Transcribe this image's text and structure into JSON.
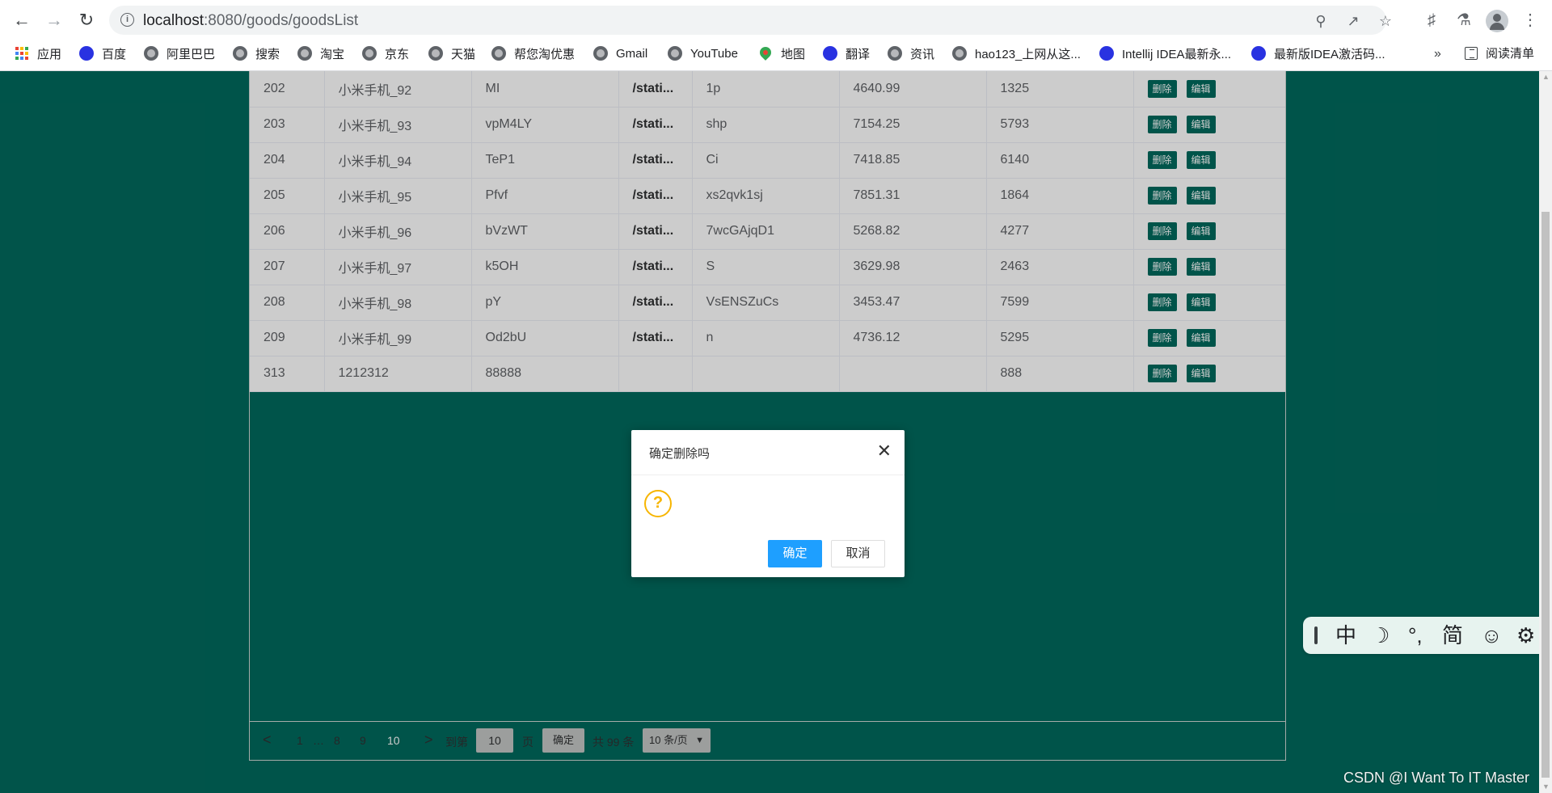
{
  "browser": {
    "url_host": "localhost",
    "url_rest": ":8080/goods/goodsList",
    "icons": [
      "back-icon",
      "forward-icon",
      "reload-icon",
      "info-icon",
      "zoom-icon",
      "share-icon",
      "star-icon",
      "extensions-icon",
      "labs-icon",
      "profile-icon",
      "menu-icon"
    ]
  },
  "bookmarks": {
    "items": [
      "应用",
      "百度",
      "阿里巴巴",
      "搜索",
      "淘宝",
      "京东",
      "天猫",
      "帮您淘优惠",
      "Gmail",
      "YouTube",
      "地图",
      "翻译",
      "资讯",
      "hao123_上网从这...",
      "Intellij IDEA最新永...",
      "最新版IDEA激活码..."
    ],
    "more": "»",
    "reading_list": "阅读清单"
  },
  "table": {
    "delete_label": "删除",
    "edit_label": "编辑",
    "rows": [
      {
        "id": "202",
        "name": "小米手机_92",
        "code": "MI",
        "img": "/stati...",
        "desc": "1p",
        "price": "4640.99",
        "stock": "1325"
      },
      {
        "id": "203",
        "name": "小米手机_93",
        "code": "vpM4LY",
        "img": "/stati...",
        "desc": "shp",
        "price": "7154.25",
        "stock": "5793"
      },
      {
        "id": "204",
        "name": "小米手机_94",
        "code": "TeP1",
        "img": "/stati...",
        "desc": "Ci",
        "price": "7418.85",
        "stock": "6140"
      },
      {
        "id": "205",
        "name": "小米手机_95",
        "code": "Pfvf",
        "img": "/stati...",
        "desc": "xs2qvk1sj",
        "price": "7851.31",
        "stock": "1864"
      },
      {
        "id": "206",
        "name": "小米手机_96",
        "code": "bVzWT",
        "img": "/stati...",
        "desc": "7wcGAjqD1",
        "price": "5268.82",
        "stock": "4277"
      },
      {
        "id": "207",
        "name": "小米手机_97",
        "code": "k5OH",
        "img": "/stati...",
        "desc": "S",
        "price": "3629.98",
        "stock": "2463"
      },
      {
        "id": "208",
        "name": "小米手机_98",
        "code": "pY",
        "img": "/stati...",
        "desc": "VsENSZuCs",
        "price": "3453.47",
        "stock": "7599"
      },
      {
        "id": "209",
        "name": "小米手机_99",
        "code": "Od2bU",
        "img": "/stati...",
        "desc": "n",
        "price": "4736.12",
        "stock": "5295"
      },
      {
        "id": "313",
        "name": "1212312",
        "code": "88888",
        "img": "",
        "desc": "",
        "price": "",
        "stock": "888"
      }
    ]
  },
  "pager": {
    "prev": "<",
    "first": "1",
    "ellipsis": "…",
    "p8": "8",
    "p9": "9",
    "current": "10",
    "next": ">",
    "goto_label": "到第",
    "goto_value": "10",
    "page_unit": "页",
    "go_button": "确定",
    "total": "共 99 条",
    "page_size": "10 条/页"
  },
  "dialog": {
    "title": "确定删除吗",
    "close": "✕",
    "icon": "?",
    "ok": "确定",
    "cancel": "取消"
  },
  "ime": {
    "items": [
      "中",
      "☽",
      "°,",
      "简",
      "☺",
      "⚙"
    ]
  },
  "watermark": "CSDN @I Want To IT Master"
}
